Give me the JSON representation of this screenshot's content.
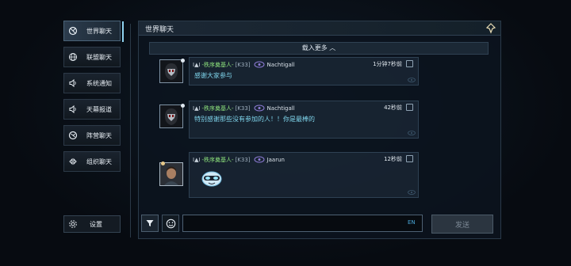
{
  "sidebar": {
    "items": [
      {
        "label": "世界聊天",
        "icon": "world-icon",
        "active": true
      },
      {
        "label": "联盟聊天",
        "icon": "globe-icon",
        "active": false
      },
      {
        "label": "系统通知",
        "icon": "speaker-icon",
        "active": false
      },
      {
        "label": "天幕报道",
        "icon": "speaker-icon",
        "active": false
      },
      {
        "label": "阵营聊天",
        "icon": "camp-icon",
        "active": false
      },
      {
        "label": "组织聊天",
        "icon": "organization-icon",
        "active": false
      }
    ],
    "settings_label": "设置"
  },
  "panel": {
    "title": "世界聊天",
    "load_more": "载入更多 ︿"
  },
  "messages": [
    {
      "rank": "I▲I",
      "guild": "-秩序奠基人-",
      "server": "[K33]",
      "username": "Nachtigall",
      "time": "1分钟7秒前",
      "text": "感谢大家参与"
    },
    {
      "rank": "I▲I",
      "guild": "-秩序奠基人-",
      "server": "[K33]",
      "username": "Nachtigall",
      "time": "42秒前",
      "text": "特别感谢那些没有参加的人！！你是最棒的"
    },
    {
      "rank": "I▲I",
      "guild": "-秩序奠基人-",
      "server": "[K33]",
      "username": "Jaarun",
      "time": "12秒前",
      "text": ""
    }
  ],
  "input": {
    "value": "",
    "placeholder": "",
    "lang": "EN"
  },
  "send_label": "发送",
  "colors": {
    "accent": "#8fd3f0",
    "guild_green": "#8de27c",
    "message_cyan": "#7fd5ec",
    "lang_blue": "#4aa6d7"
  }
}
